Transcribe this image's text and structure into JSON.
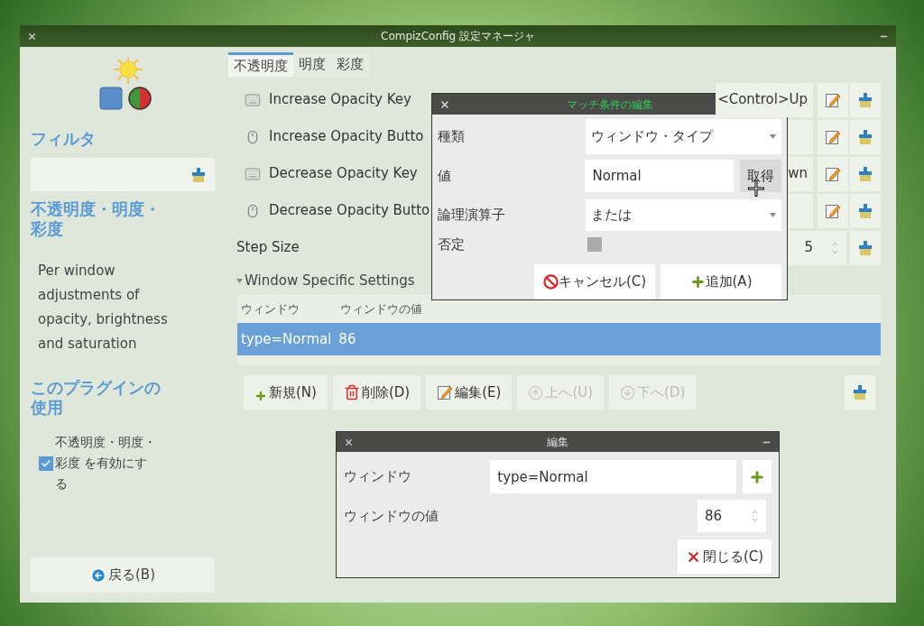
{
  "window": {
    "title": "CompizConfig 設定マネージャ"
  },
  "sidebar": {
    "filter_label": "フィルタ",
    "plugin_title": "不透明度・明度・彩度",
    "description": "Per window adjustments of opacity, brightness and saturation",
    "use_heading": "このプラグインの使用",
    "enable": {
      "label": "不透明度・明度・彩度 を有効にする",
      "checked": true
    },
    "back_button": "戻る(B)"
  },
  "tabs": [
    {
      "label": "不透明度",
      "selected": true
    },
    {
      "label": "明度",
      "selected": false
    },
    {
      "label": "彩度",
      "selected": false
    }
  ],
  "settings": [
    {
      "kind": "key",
      "label": "Increase Opacity Key",
      "value": "<Control>Up"
    },
    {
      "kind": "button",
      "label": "Increase Opacity Butto"
    },
    {
      "kind": "key",
      "label": "Decrease Opacity Key",
      "value": "wn"
    },
    {
      "kind": "button",
      "label": "Decrease Opacity Butto"
    },
    {
      "kind": "number",
      "label": "Step Size",
      "value": "5"
    }
  ],
  "window_specific": {
    "label": "Window Specific Settings",
    "expanded": true,
    "columns": [
      "ウィンドウ",
      "ウィンドウの値"
    ],
    "rows": [
      {
        "cells": [
          "type=Normal",
          "86"
        ],
        "selected": true
      }
    ],
    "buttons": [
      {
        "kind": "new",
        "label": "新規(N)",
        "disabled": false
      },
      {
        "kind": "delete",
        "label": "削除(D)",
        "disabled": false
      },
      {
        "kind": "edit",
        "label": "編集(E)",
        "disabled": false
      },
      {
        "kind": "up",
        "label": "上へ(U)",
        "disabled": true
      },
      {
        "kind": "down",
        "label": "下へ(D)",
        "disabled": true
      }
    ]
  },
  "match_dialog": {
    "title": "マッチ条件の編集",
    "type_label": "種類",
    "type_value": "ウィンドウ・タイプ",
    "value_label": "値",
    "value": "Normal",
    "grab_button": "取得",
    "operator_label": "論理演算子",
    "operator_value": "または",
    "negate_label": "否定",
    "negate_checked": false,
    "cancel_button": "キャンセル(C)",
    "add_button": "追加(A)"
  },
  "edit_dialog": {
    "title": "編集",
    "window_label": "ウィンドウ",
    "window_value": "type=Normal",
    "value_label": "ウィンドウの値",
    "value": "86",
    "close_button": "閉じる(C)"
  }
}
